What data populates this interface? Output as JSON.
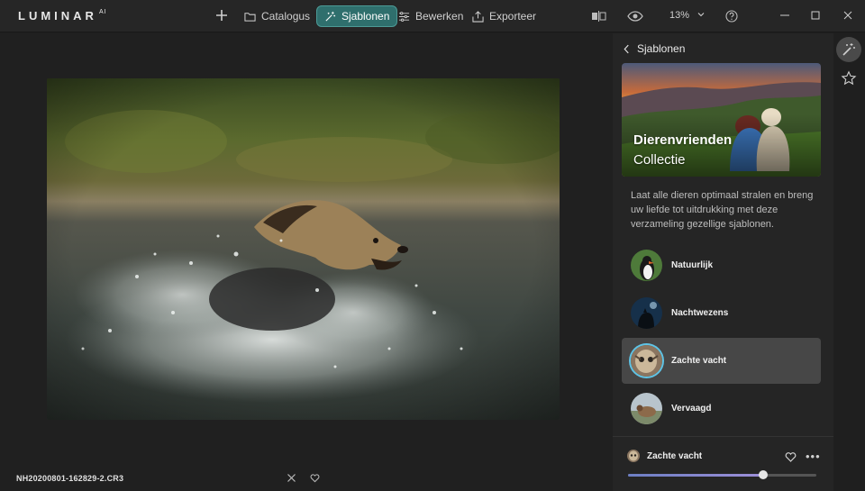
{
  "app": {
    "logo": "LUMINAR",
    "logo_sup": "AI"
  },
  "topbar": {
    "nav": [
      {
        "label": "Catalogus",
        "icon": "folder-icon",
        "active": false
      },
      {
        "label": "Sjablonen",
        "icon": "magic-sparkle-icon",
        "active": true
      },
      {
        "label": "Bewerken",
        "icon": "sliders-icon",
        "active": false
      },
      {
        "label": "Exporteer",
        "icon": "export-icon",
        "active": false
      }
    ],
    "zoom": "13%"
  },
  "canvas": {
    "filename": "NH20200801-162829-2.CR3"
  },
  "panel": {
    "back_label": "Sjablonen",
    "hero_title": "Dierenvrienden",
    "hero_subtitle": "Collectie",
    "description": "Laat alle dieren optimaal stralen en breng uw liefde tot uitdrukking met deze verzameling gezellige sjablonen.",
    "templates": [
      {
        "label": "Natuurlijk",
        "selected": false
      },
      {
        "label": "Nachtwezens",
        "selected": false
      },
      {
        "label": "Zachte vacht",
        "selected": true
      },
      {
        "label": "Vervaagd",
        "selected": false
      }
    ],
    "applied": {
      "label": "Zachte vacht",
      "amount": 0.72
    }
  },
  "colors": {
    "accent": "#2f6f6d",
    "selection_ring": "#5fc4e6"
  }
}
